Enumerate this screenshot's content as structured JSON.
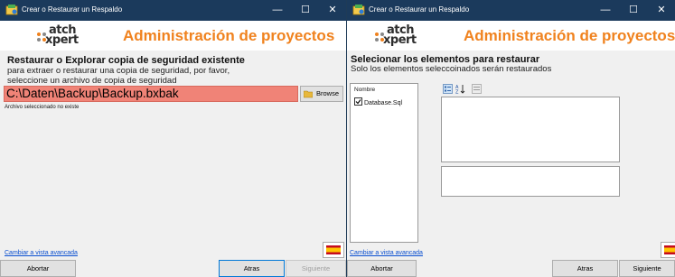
{
  "colors": {
    "titlebar": "#1b3a5c",
    "accent_title": "#f0821e",
    "error_field": "#f08377",
    "link": "#0a4fd0"
  },
  "window_left": {
    "title": "Crear o Restaurar un Respaldo",
    "controls": {
      "minimize": "—",
      "maximize": "☐",
      "close": "✕"
    },
    "logo": {
      "top": "atch",
      "bottom": "xpert"
    },
    "app_title": "Administración de proyectos",
    "heading": "Restaurar o Explorar copia de seguridad existente",
    "instructions_line1": "para extraer o restaurar una copia de seguridad, por favor,",
    "instructions_line2": "seleccione un archivo de copia de seguridad",
    "path_value": "C:\\Daten\\Backup\\Backup.bxbak",
    "browse_label": "Browse",
    "browse_icon": "folder-icon",
    "error_text": "Archivo seleccionado no existe",
    "advanced_link": "Cambiar a vista avancada",
    "flag_icon": "spain-flag-icon",
    "buttons": {
      "abort": "Abortar",
      "back": "Atras",
      "next": "Siguiente"
    }
  },
  "window_right": {
    "title": "Crear o Restaurar un Respaldo",
    "controls": {
      "minimize": "—",
      "maximize": "☐",
      "close": "✕"
    },
    "logo": {
      "top": "atch",
      "bottom": "xpert"
    },
    "app_title": "Administración de proyectos",
    "heading": "Selecionar los elementos para restaurar",
    "instructions": "Solo los elementos seleccoinados serán restaurados",
    "list_header": "Nombre",
    "list_items": [
      {
        "label": "Database.Sql",
        "checked": true
      }
    ],
    "toolbar_icons": [
      "categorized-icon",
      "sort-alpha-icon",
      "property-pages-icon"
    ],
    "advanced_link": "Cambiar a vista avancada",
    "flag_icon": "spain-flag-icon",
    "buttons": {
      "abort": "Abortar",
      "back": "Atras",
      "next": "Siguiente"
    }
  }
}
